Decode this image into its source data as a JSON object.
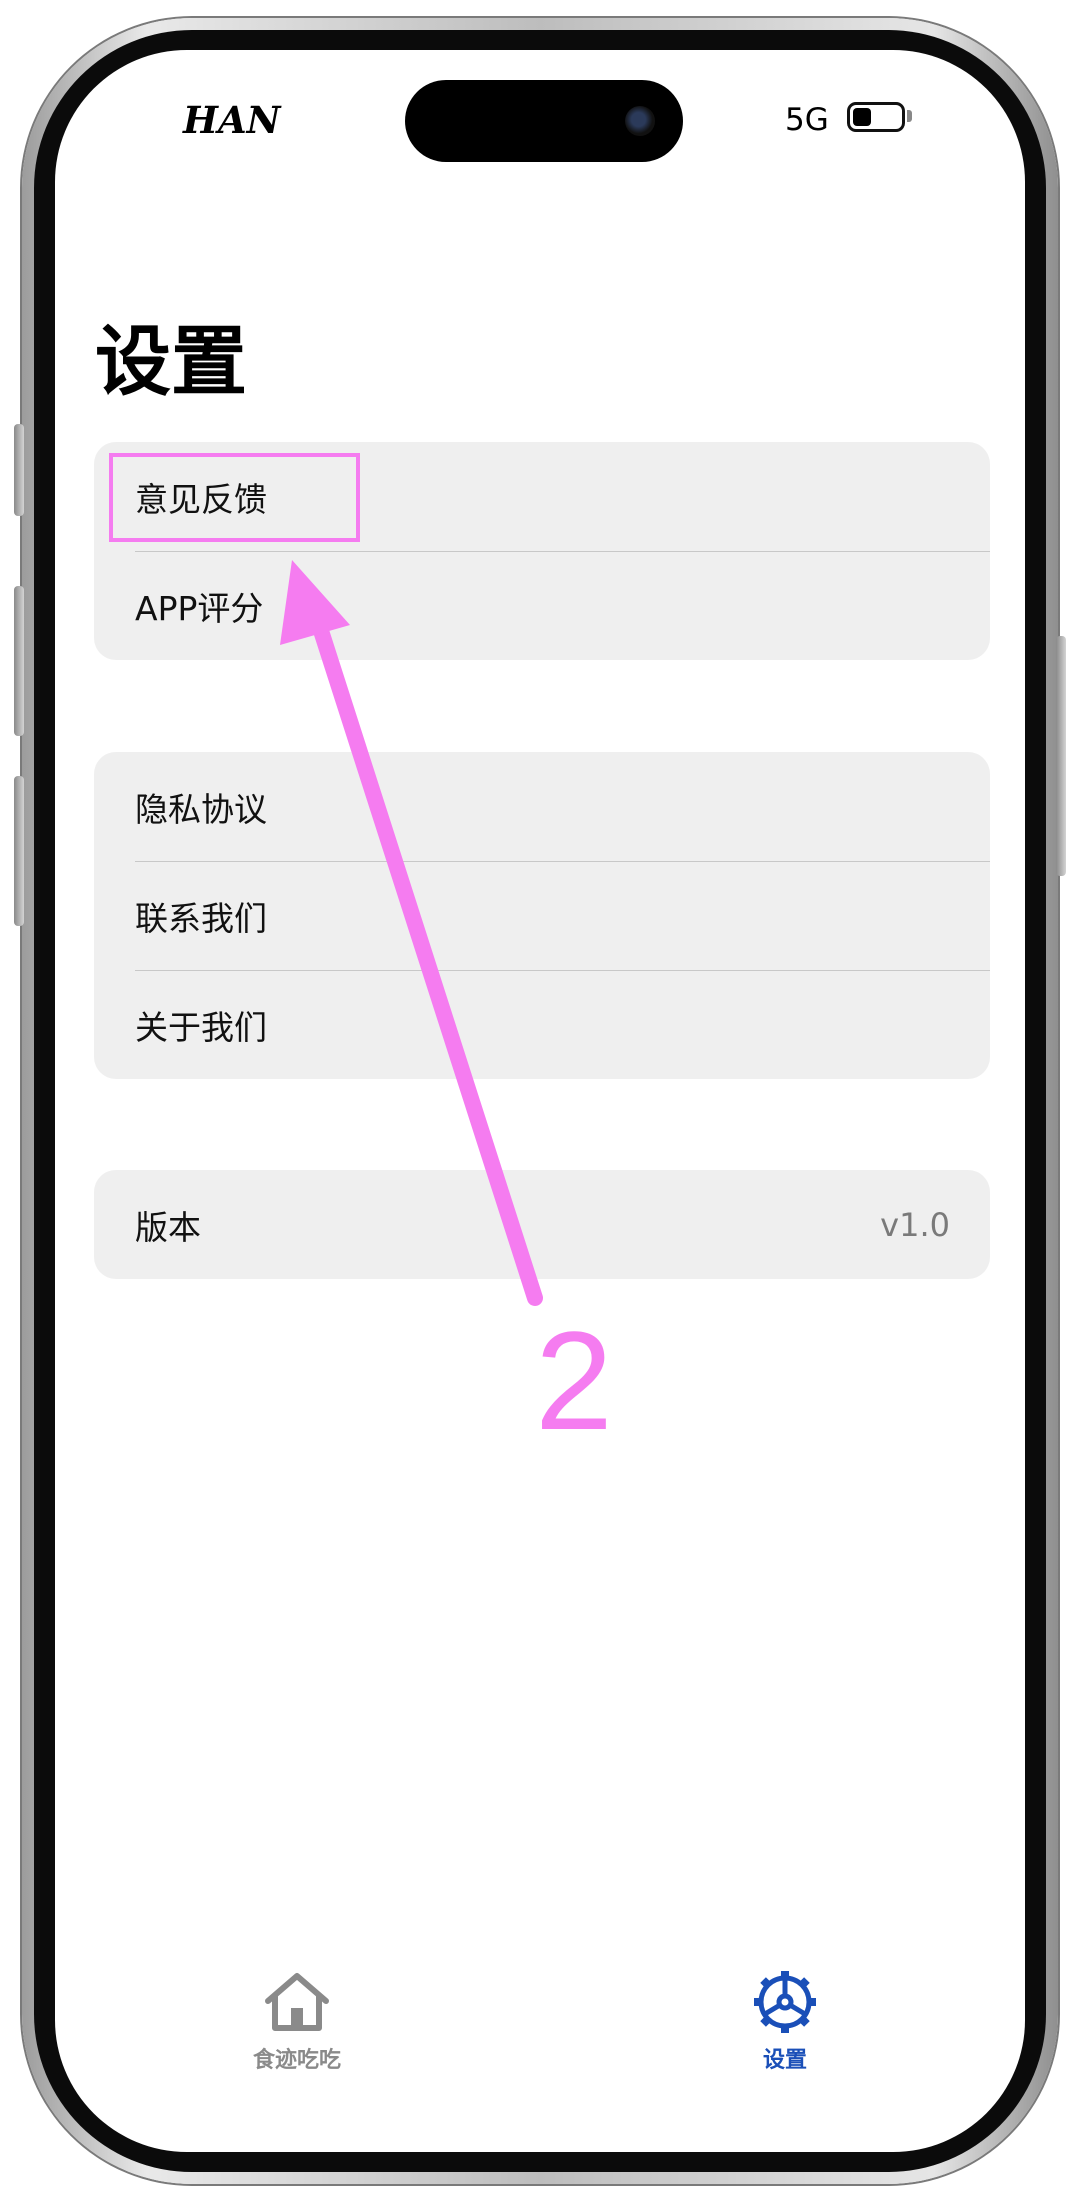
{
  "status_bar": {
    "carrier": "HAN",
    "network": "5G"
  },
  "page_title": "设置",
  "groups": [
    {
      "items": [
        {
          "label": "意见反馈"
        },
        {
          "label": "APP评分"
        }
      ]
    },
    {
      "items": [
        {
          "label": "隐私协议"
        },
        {
          "label": "联系我们"
        },
        {
          "label": "关于我们"
        }
      ]
    },
    {
      "items": [
        {
          "label": "版本",
          "value": "v1.0"
        }
      ]
    }
  ],
  "annotation": {
    "step_number": "2",
    "color": "#f57cf0"
  },
  "tabbar": {
    "tabs": [
      {
        "label": "食迹吃吃",
        "icon": "house-icon",
        "active": false
      },
      {
        "label": "设置",
        "icon": "gear-icon",
        "active": true
      }
    ],
    "active_color": "#1a4fb8",
    "inactive_color": "#8a8a8a"
  }
}
